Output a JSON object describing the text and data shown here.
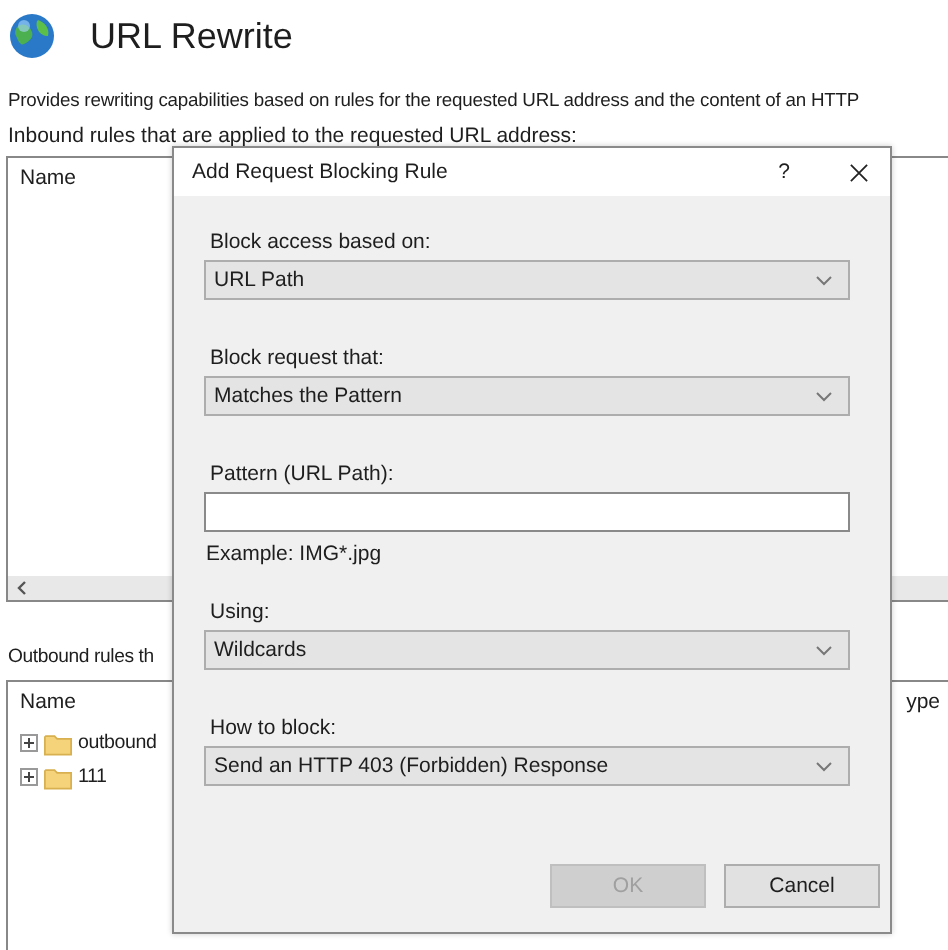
{
  "page": {
    "title": "URL Rewrite",
    "description": "Provides rewriting capabilities based on rules for the requested URL address and the content of an HTTP",
    "inbound_label": "Inbound rules that are applied to the requested URL address:",
    "inbound_table": {
      "columns": [
        "Name"
      ]
    },
    "outbound_label": "Outbound rules th",
    "outbound_table": {
      "columns": [
        "Name",
        "ype"
      ],
      "rows": [
        {
          "name": "outbound",
          "expanded": false
        },
        {
          "name": "111",
          "expanded": false
        }
      ]
    }
  },
  "dialog": {
    "title": "Add Request Blocking Rule",
    "help": "?",
    "fields": [
      {
        "kind": "select",
        "label": "Block access based on:",
        "value": "URL Path"
      },
      {
        "kind": "select",
        "label": "Block request that:",
        "value": "Matches the Pattern"
      },
      {
        "kind": "text",
        "label": "Pattern (URL Path):",
        "hint": "Example: IMG*.jpg"
      },
      {
        "kind": "select",
        "label": "Using:",
        "value": "Wildcards"
      },
      {
        "kind": "select",
        "label": "How to block:",
        "value": "Send an HTTP 403 (Forbidden) Response"
      }
    ],
    "buttons": [
      {
        "label": "OK",
        "disabled": true
      },
      {
        "label": "Cancel",
        "disabled": false
      }
    ]
  }
}
